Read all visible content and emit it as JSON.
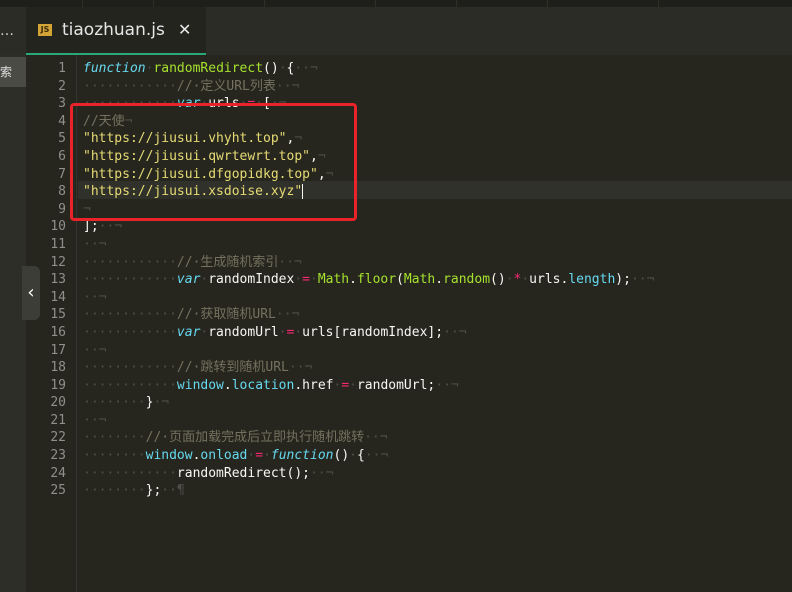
{
  "editor": {
    "tab_title": "tiaozhuan.js",
    "tab_icon_text": "JS",
    "close_glyph": "✕",
    "side_dots": "…",
    "search_tab_label": "搜索",
    "collapse_glyph": "‹",
    "cursor_line": 8
  },
  "lines": [
    {
      "n": "1",
      "tokens": [
        {
          "t": "kw",
          "v": "function"
        },
        {
          "t": "ws",
          "v": "·"
        },
        {
          "t": "fn",
          "v": "randomRedirect"
        },
        {
          "t": "tx",
          "v": "()"
        },
        {
          "t": "ws",
          "v": "·"
        },
        {
          "t": "tx",
          "v": "{"
        },
        {
          "t": "ws",
          "v": "··¬"
        }
      ]
    },
    {
      "n": "2",
      "tokens": [
        {
          "t": "ws",
          "v": "············"
        },
        {
          "t": "cm",
          "v": "//·定义URL列表"
        },
        {
          "t": "ws",
          "v": "··¬"
        }
      ]
    },
    {
      "n": "3",
      "tokens": [
        {
          "t": "ws",
          "v": "············"
        },
        {
          "t": "kw",
          "v": "var"
        },
        {
          "t": "ws",
          "v": "·"
        },
        {
          "t": "tx",
          "v": "urls"
        },
        {
          "t": "ws",
          "v": "·"
        },
        {
          "t": "op",
          "v": "="
        },
        {
          "t": "ws",
          "v": "·"
        },
        {
          "t": "tx",
          "v": "["
        },
        {
          "t": "ws",
          "v": "·¬"
        }
      ]
    },
    {
      "n": "4",
      "tokens": [
        {
          "t": "cm",
          "v": "//天使"
        },
        {
          "t": "ws",
          "v": "¬"
        }
      ]
    },
    {
      "n": "5",
      "tokens": [
        {
          "t": "st",
          "v": "\"https://jiusui.vhyht.top\""
        },
        {
          "t": "tx",
          "v": ","
        },
        {
          "t": "ws",
          "v": "¬"
        }
      ]
    },
    {
      "n": "6",
      "tokens": [
        {
          "t": "st",
          "v": "\"https://jiusui.qwrtewrt.top\""
        },
        {
          "t": "tx",
          "v": ","
        },
        {
          "t": "ws",
          "v": "¬"
        }
      ]
    },
    {
      "n": "7",
      "tokens": [
        {
          "t": "st",
          "v": "\"https://jiusui.dfgopidkg.top\""
        },
        {
          "t": "tx",
          "v": ","
        },
        {
          "t": "ws",
          "v": "¬"
        }
      ]
    },
    {
      "n": "8",
      "tokens": [
        {
          "t": "st",
          "v": "\"https://jiusui.xsdoise.xyz\""
        },
        {
          "t": "cursor",
          "v": ""
        }
      ]
    },
    {
      "n": "9",
      "tokens": [
        {
          "t": "ws",
          "v": "¬"
        }
      ]
    },
    {
      "n": "10",
      "tokens": [
        {
          "t": "tx",
          "v": "];"
        },
        {
          "t": "ws",
          "v": "··¬"
        }
      ]
    },
    {
      "n": "11",
      "tokens": [
        {
          "t": "ws",
          "v": "··¬"
        }
      ]
    },
    {
      "n": "12",
      "tokens": [
        {
          "t": "ws",
          "v": "············"
        },
        {
          "t": "cm",
          "v": "//·生成随机索引"
        },
        {
          "t": "ws",
          "v": "··¬"
        }
      ]
    },
    {
      "n": "13",
      "tokens": [
        {
          "t": "ws",
          "v": "············"
        },
        {
          "t": "kw",
          "v": "var"
        },
        {
          "t": "ws",
          "v": "·"
        },
        {
          "t": "tx",
          "v": "randomIndex"
        },
        {
          "t": "ws",
          "v": "·"
        },
        {
          "t": "op",
          "v": "="
        },
        {
          "t": "ws",
          "v": "·"
        },
        {
          "t": "fn",
          "v": "Math"
        },
        {
          "t": "tx",
          "v": "."
        },
        {
          "t": "fn",
          "v": "floor"
        },
        {
          "t": "tx",
          "v": "("
        },
        {
          "t": "fn",
          "v": "Math"
        },
        {
          "t": "tx",
          "v": "."
        },
        {
          "t": "fn",
          "v": "random"
        },
        {
          "t": "tx",
          "v": "()"
        },
        {
          "t": "ws",
          "v": "·"
        },
        {
          "t": "op",
          "v": "*"
        },
        {
          "t": "ws",
          "v": "·"
        },
        {
          "t": "tx",
          "v": "urls"
        },
        {
          "t": "tx",
          "v": "."
        },
        {
          "t": "pr",
          "v": "length"
        },
        {
          "t": "tx",
          "v": ");"
        },
        {
          "t": "ws",
          "v": "··¬"
        }
      ]
    },
    {
      "n": "14",
      "tokens": [
        {
          "t": "ws",
          "v": "··¬"
        }
      ]
    },
    {
      "n": "15",
      "tokens": [
        {
          "t": "ws",
          "v": "············"
        },
        {
          "t": "cm",
          "v": "//·获取随机URL"
        },
        {
          "t": "ws",
          "v": "··¬"
        }
      ]
    },
    {
      "n": "16",
      "tokens": [
        {
          "t": "ws",
          "v": "············"
        },
        {
          "t": "kw",
          "v": "var"
        },
        {
          "t": "ws",
          "v": "·"
        },
        {
          "t": "tx",
          "v": "randomUrl"
        },
        {
          "t": "ws",
          "v": "·"
        },
        {
          "t": "op",
          "v": "="
        },
        {
          "t": "ws",
          "v": "·"
        },
        {
          "t": "tx",
          "v": "urls[randomIndex];"
        },
        {
          "t": "ws",
          "v": "··¬"
        }
      ]
    },
    {
      "n": "17",
      "tokens": [
        {
          "t": "ws",
          "v": "··¬"
        }
      ]
    },
    {
      "n": "18",
      "tokens": [
        {
          "t": "ws",
          "v": "············"
        },
        {
          "t": "cm",
          "v": "//·跳转到随机URL"
        },
        {
          "t": "ws",
          "v": "··¬"
        }
      ]
    },
    {
      "n": "19",
      "tokens": [
        {
          "t": "ws",
          "v": "············"
        },
        {
          "t": "pr",
          "v": "window"
        },
        {
          "t": "tx",
          "v": "."
        },
        {
          "t": "pr",
          "v": "location"
        },
        {
          "t": "tx",
          "v": ".href"
        },
        {
          "t": "ws",
          "v": "·"
        },
        {
          "t": "op",
          "v": "="
        },
        {
          "t": "ws",
          "v": "·"
        },
        {
          "t": "tx",
          "v": "randomUrl;"
        },
        {
          "t": "ws",
          "v": "··¬"
        }
      ]
    },
    {
      "n": "20",
      "tokens": [
        {
          "t": "ws",
          "v": "········"
        },
        {
          "t": "tx",
          "v": "}"
        },
        {
          "t": "ws",
          "v": "·¬"
        }
      ]
    },
    {
      "n": "21",
      "tokens": [
        {
          "t": "ws",
          "v": "··¬"
        }
      ]
    },
    {
      "n": "22",
      "tokens": [
        {
          "t": "ws",
          "v": "········"
        },
        {
          "t": "cm",
          "v": "//·页面加载完成后立即执行随机跳转"
        },
        {
          "t": "ws",
          "v": "··¬"
        }
      ]
    },
    {
      "n": "23",
      "tokens": [
        {
          "t": "ws",
          "v": "········"
        },
        {
          "t": "pr",
          "v": "window"
        },
        {
          "t": "tx",
          "v": "."
        },
        {
          "t": "pr",
          "v": "onload"
        },
        {
          "t": "ws",
          "v": "·"
        },
        {
          "t": "op",
          "v": "="
        },
        {
          "t": "ws",
          "v": "·"
        },
        {
          "t": "kw",
          "v": "function"
        },
        {
          "t": "tx",
          "v": "()"
        },
        {
          "t": "ws",
          "v": "·"
        },
        {
          "t": "tx",
          "v": "{"
        },
        {
          "t": "ws",
          "v": "··¬"
        }
      ]
    },
    {
      "n": "24",
      "tokens": [
        {
          "t": "ws",
          "v": "············"
        },
        {
          "t": "tx",
          "v": "randomRedirect();"
        },
        {
          "t": "ws",
          "v": "··¬"
        }
      ]
    },
    {
      "n": "25",
      "tokens": [
        {
          "t": "ws",
          "v": "········"
        },
        {
          "t": "tx",
          "v": "};"
        },
        {
          "t": "ws",
          "v": "··¶"
        }
      ]
    }
  ],
  "colors": {
    "background": "#26261f",
    "keyword": "#66d9ef",
    "function": "#a6e22e",
    "comment": "#75715e",
    "string": "#e6db74",
    "operator": "#f92672",
    "highlight_box": "#e8242a",
    "tab_accent": "#2aa87a"
  }
}
